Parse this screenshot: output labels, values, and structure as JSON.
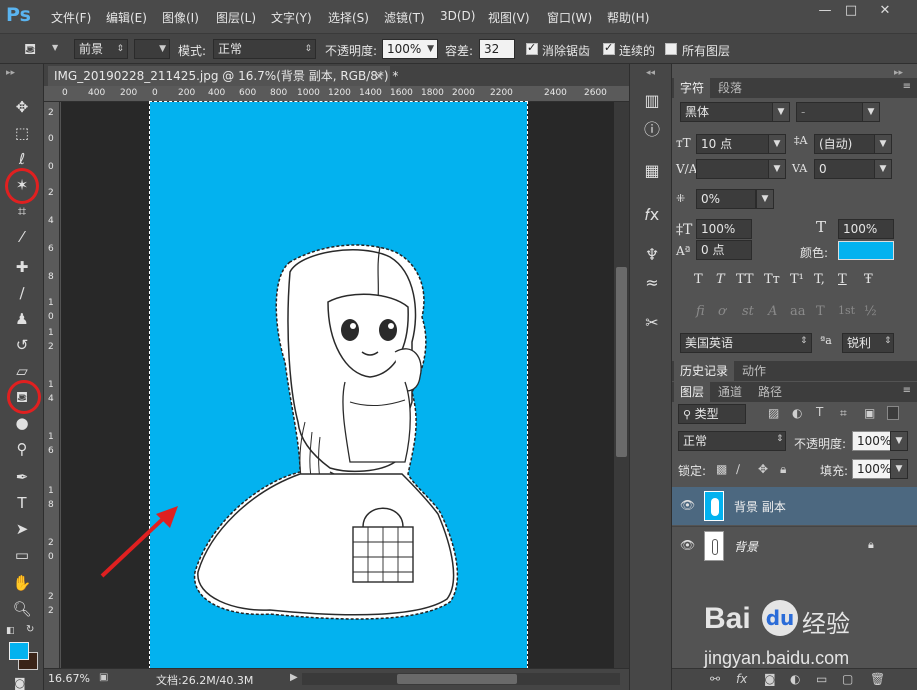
{
  "app": {
    "logo": "Ps"
  },
  "menu": [
    "文件(F)",
    "编辑(E)",
    "图像(I)",
    "图层(L)",
    "文字(Y)",
    "选择(S)",
    "滤镜(T)",
    "3D(D)",
    "视图(V)",
    "窗口(W)",
    "帮助(H)"
  ],
  "window_controls": {
    "minimize": "—",
    "restore": "□",
    "close": "✕"
  },
  "options": {
    "fill_source": "前景",
    "mode_label": "模式:",
    "mode_value": "正常",
    "opacity_label": "不透明度:",
    "opacity_value": "100%",
    "tolerance_label": "容差:",
    "tolerance_value": "32",
    "antialias": "消除锯齿",
    "contiguous": "连续的",
    "all_layers": "所有图层",
    "antialias_checked": true,
    "contiguous_checked": true,
    "all_layers_checked": false
  },
  "document": {
    "tab_title": "IMG_20190228_211425.jpg @ 16.7%(背景 副本, RGB/8*) *",
    "tab_close": "×",
    "ruler_h": [
      "0",
      "400",
      "200",
      "0",
      "200",
      "400",
      "600",
      "800",
      "1000",
      "1200",
      "1400",
      "1600",
      "1800",
      "2000",
      "2200",
      "2400",
      "2600"
    ],
    "ruler_v": [
      "2",
      "0",
      "0",
      "2",
      "4",
      "6",
      "8",
      "1",
      "0",
      "1",
      "2",
      "1",
      "4",
      "1",
      "6",
      "1",
      "8",
      "2",
      "0",
      "2",
      "2"
    ],
    "zoom": "16.67%",
    "doc_size": "文档:26.2M/40.3M",
    "canvas_color": "#03b2ef"
  },
  "toolbar_icons": [
    "move-icon",
    "marquee-icon",
    "lasso-icon",
    "magic-wand-icon",
    "crop-icon",
    "eyedropper-icon",
    "healing-icon",
    "brush-icon",
    "stamp-icon",
    "history-brush-icon",
    "eraser-icon",
    "paint-bucket-icon",
    "blur-icon",
    "dodge-icon",
    "pen-icon",
    "type-icon",
    "path-select-icon",
    "shape-icon",
    "hand-icon",
    "zoom-icon"
  ],
  "character_panel": {
    "tab_character": "字符",
    "tab_paragraph": "段落",
    "font_family": "黑体",
    "font_style": "-",
    "font_size": "10 点",
    "leading": "(自动)",
    "kerning": "",
    "tracking": "0",
    "scale_pct": "0%",
    "vscale": "100%",
    "hscale": "100%",
    "baseline": "0 点",
    "color_label": "颜色:",
    "color": "#03b2ef",
    "style_buttons": [
      "T",
      "T",
      "TT",
      "Tт",
      "T¹",
      "T,",
      "T",
      "Ŧ"
    ],
    "opentype_buttons": [
      "fi",
      "ơ",
      "st",
      "A",
      "aa",
      "T",
      "1st",
      "½"
    ],
    "language": "美国英语",
    "aa_label": "ªa",
    "antialias": "锐利"
  },
  "history_panel": {
    "tab_history": "历史记录",
    "tab_actions": "动作"
  },
  "layers_panel": {
    "tab_layers": "图层",
    "tab_channels": "通道",
    "tab_paths": "路径",
    "filter_kind": "类型",
    "blend_mode": "正常",
    "opacity_label": "不透明度:",
    "opacity_value": "100%",
    "lock_label": "锁定:",
    "fill_label": "填充:",
    "fill_value": "100%",
    "layers": [
      {
        "name": "背景 副本",
        "selected": true
      },
      {
        "name": "背景",
        "selected": false
      }
    ]
  },
  "watermark": {
    "brand": "Bai",
    "brand2": "经验",
    "url": "jingyan.baidu.com"
  }
}
